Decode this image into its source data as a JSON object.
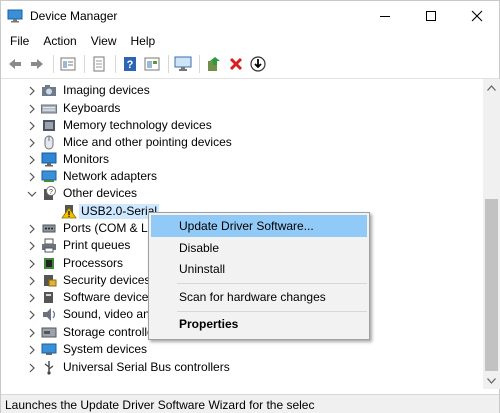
{
  "window": {
    "title": "Device Manager",
    "title_icon": "device-manager-icon",
    "controls": {
      "minimize": "minimize-icon",
      "maximize": "maximize-icon",
      "close": "close-icon"
    }
  },
  "menu": [
    "File",
    "Action",
    "View",
    "Help"
  ],
  "toolbar": [
    "back-arrow-icon",
    "forward-arrow-icon",
    "properties-icon",
    "show-hidden-icon",
    "help-icon",
    "view-icon",
    "monitor-scan-icon",
    "update-driver-icon",
    "uninstall-x-icon",
    "download-driver-icon"
  ],
  "tree": {
    "items": [
      {
        "label": "Imaging devices",
        "icon": "camera-icon",
        "expanded": false
      },
      {
        "label": "Keyboards",
        "icon": "keyboard-icon",
        "expanded": false
      },
      {
        "label": "Memory technology devices",
        "icon": "memory-icon",
        "expanded": false
      },
      {
        "label": "Mice and other pointing devices",
        "icon": "mouse-icon",
        "expanded": false
      },
      {
        "label": "Monitors",
        "icon": "monitor-icon",
        "expanded": false
      },
      {
        "label": "Network adapters",
        "icon": "network-icon",
        "expanded": false
      },
      {
        "label": "Other devices",
        "icon": "unknown-device-icon",
        "expanded": true
      },
      {
        "label": "USB2.0-Serial",
        "icon": "warning-device-icon",
        "child": true
      },
      {
        "label": "Ports (COM & LPT)",
        "icon": "port-icon",
        "expanded": false
      },
      {
        "label": "Print queues",
        "icon": "printer-icon",
        "expanded": false
      },
      {
        "label": "Processors",
        "icon": "processor-icon",
        "expanded": false
      },
      {
        "label": "Security devices",
        "icon": "security-icon",
        "expanded": false
      },
      {
        "label": "Software devices",
        "icon": "software-icon",
        "expanded": false
      },
      {
        "label": "Sound, video and game controllers",
        "icon": "speaker-icon",
        "expanded": false
      },
      {
        "label": "Storage controllers",
        "icon": "storage-icon",
        "expanded": false
      },
      {
        "label": "System devices",
        "icon": "system-icon",
        "expanded": false
      },
      {
        "label": "Universal Serial Bus controllers",
        "icon": "usb-icon",
        "expanded": false
      }
    ]
  },
  "context_menu": {
    "items": [
      {
        "label": "Update Driver Software...",
        "highlighted": true
      },
      {
        "label": "Disable"
      },
      {
        "label": "Uninstall"
      },
      {
        "label": "Scan for hardware changes"
      },
      {
        "label": "Properties",
        "bold": true
      }
    ]
  },
  "status": "Launches the Update Driver Software Wizard for the selec",
  "colors": {
    "highlight": "#91c9f7",
    "selection": "#cde8ff",
    "accent": "#1e78d6",
    "warning": "#f2c200",
    "danger": "#d81e1e"
  }
}
